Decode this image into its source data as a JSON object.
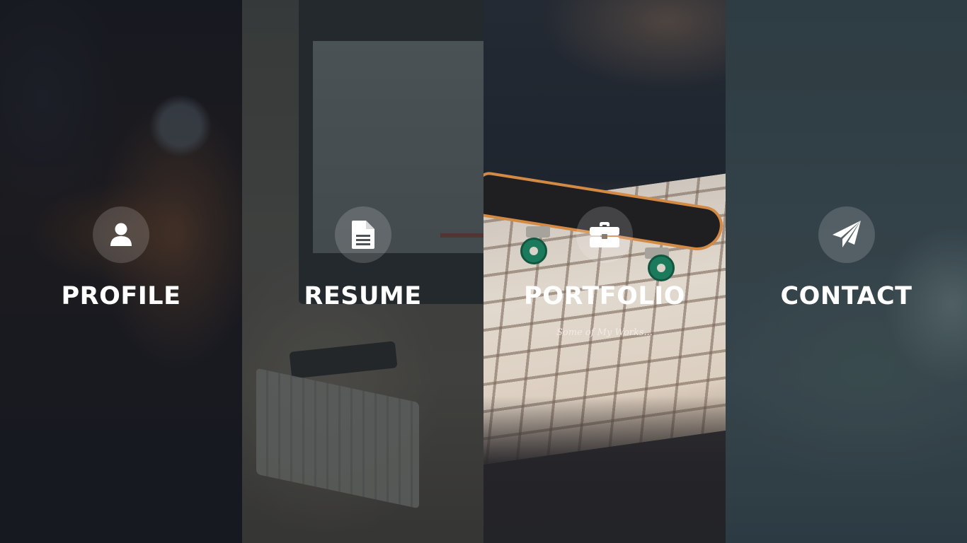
{
  "panels": [
    {
      "id": "profile",
      "title": "PROFILE",
      "subtitle": "",
      "icon": "user-icon"
    },
    {
      "id": "resume",
      "title": "RESUME",
      "subtitle": "",
      "icon": "document-icon"
    },
    {
      "id": "portfolio",
      "title": "PORTFOLIO",
      "subtitle": "Some of My Works...",
      "icon": "briefcase-icon"
    },
    {
      "id": "contact",
      "title": "CONTACT",
      "subtitle": "",
      "icon": "paper-plane-icon"
    }
  ],
  "colors": {
    "icon_circle": "rgba(255,255,255,0.16)",
    "title_text": "#ffffff",
    "accent_skateboard": "#d38a45",
    "accent_wheels": "#1c7a5c"
  }
}
